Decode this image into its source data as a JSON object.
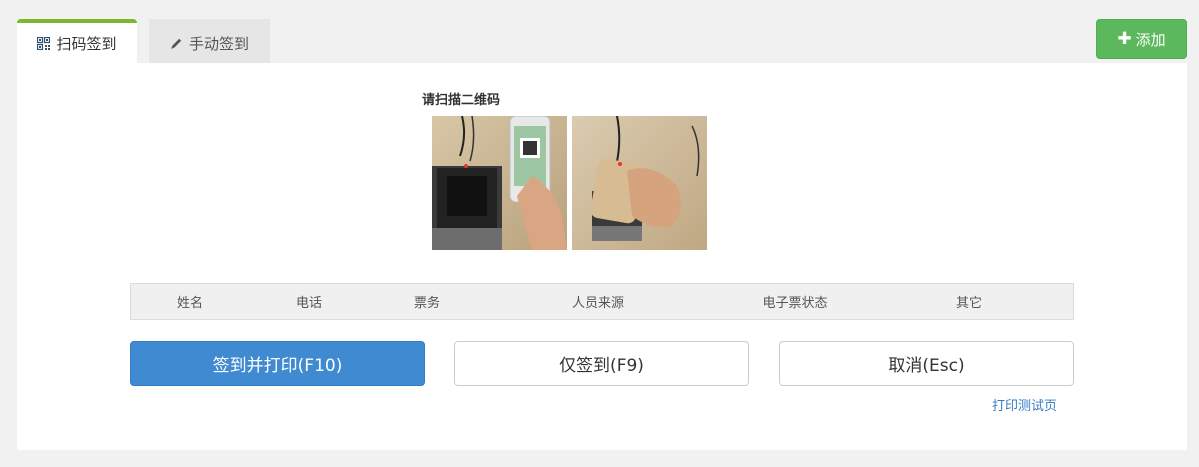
{
  "tabs": [
    {
      "label": "扫码签到",
      "icon": "qrcode-icon",
      "active": true
    },
    {
      "label": "手动签到",
      "icon": "pencil-icon",
      "active": false
    }
  ],
  "add_button": {
    "label": "添加",
    "icon": "plus-icon",
    "color": "#5cb85c"
  },
  "scan": {
    "title": "请扫描二维码",
    "images": [
      "scanner-phone-qrcode-photo",
      "scanner-phone-placed-photo"
    ]
  },
  "table": {
    "columns": [
      "姓名",
      "电话",
      "票务",
      "人员来源",
      "电子票状态",
      "其它"
    ]
  },
  "actions": {
    "sign_print": "签到并打印(F10)",
    "sign_only": "仅签到(F9)",
    "cancel": "取消(Esc)",
    "test_page": "打印测试页"
  },
  "colors": {
    "tab_accent": "#7cb82f",
    "primary": "#3f8ad0",
    "link": "#3b7bc2"
  }
}
